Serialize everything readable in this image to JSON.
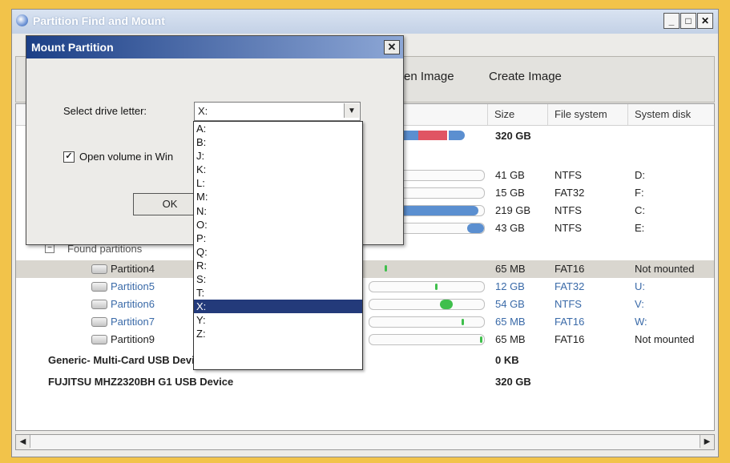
{
  "window": {
    "title": "Partition Find and Mount",
    "controls": [
      "_",
      "□",
      "✕"
    ],
    "icon": "app-disk-icon"
  },
  "toolbar": {
    "open_image": "Open Image",
    "create_image": "Create Image"
  },
  "table": {
    "headers": {
      "size": "Size",
      "file_system": "File system",
      "system_disk": "System disk"
    },
    "disk_row": {
      "size": "320 GB"
    },
    "partitions": [
      {
        "size": "41 GB",
        "fs": "NTFS",
        "disk": "D:",
        "usage": 0.0
      },
      {
        "size": "15 GB",
        "fs": "FAT32",
        "disk": "F:",
        "usage": 0.0
      },
      {
        "size": "219 GB",
        "fs": "NTFS",
        "disk": "C:",
        "usage": 0.95
      },
      {
        "size": "43 GB",
        "fs": "NTFS",
        "disk": "E:",
        "usage": 0.15
      }
    ],
    "found_label": "Found partitions",
    "found": [
      {
        "name": "Partition4",
        "size": "65 MB",
        "fs": "FAT16",
        "disk": "Not mounted"
      },
      {
        "name": "Partition5",
        "size": "12 GB",
        "fs": "FAT32",
        "disk": "U:"
      },
      {
        "name": "Partition6",
        "size": "54 GB",
        "fs": "NTFS",
        "disk": "V:"
      },
      {
        "name": "Partition7",
        "size": "65 MB",
        "fs": "FAT16",
        "disk": "W:"
      },
      {
        "name": "Partition9",
        "size": "65 MB",
        "fs": "FAT16",
        "disk": "Not mounted"
      }
    ],
    "devices": [
      {
        "name": "Generic- Multi-Card USB Device",
        "size": "0 KB"
      },
      {
        "name": "FUJITSU MHZ2320BH G1 USB Device",
        "size": "320 GB"
      }
    ]
  },
  "dialog": {
    "title": "Mount Partition",
    "close": "✕",
    "select_label": "Select drive letter:",
    "selected_letter": "X:",
    "open_volume_label": "Open volume in Win",
    "checkbox_mark": "✓",
    "ok": "OK",
    "letters": [
      "A:",
      "B:",
      "J:",
      "K:",
      "L:",
      "M:",
      "N:",
      "O:",
      "P:",
      "Q:",
      "R:",
      "S:",
      "T:",
      "X:",
      "Y:",
      "Z:"
    ]
  },
  "scroll": {
    "left": "◀",
    "right": "▶"
  },
  "colors": {
    "dialog_title": "#1c3f86",
    "selected_option": "#233a7a",
    "bar_blue": "#5b8fd0",
    "bar_green": "#3fbf4c",
    "bar_red": "#e05563"
  }
}
